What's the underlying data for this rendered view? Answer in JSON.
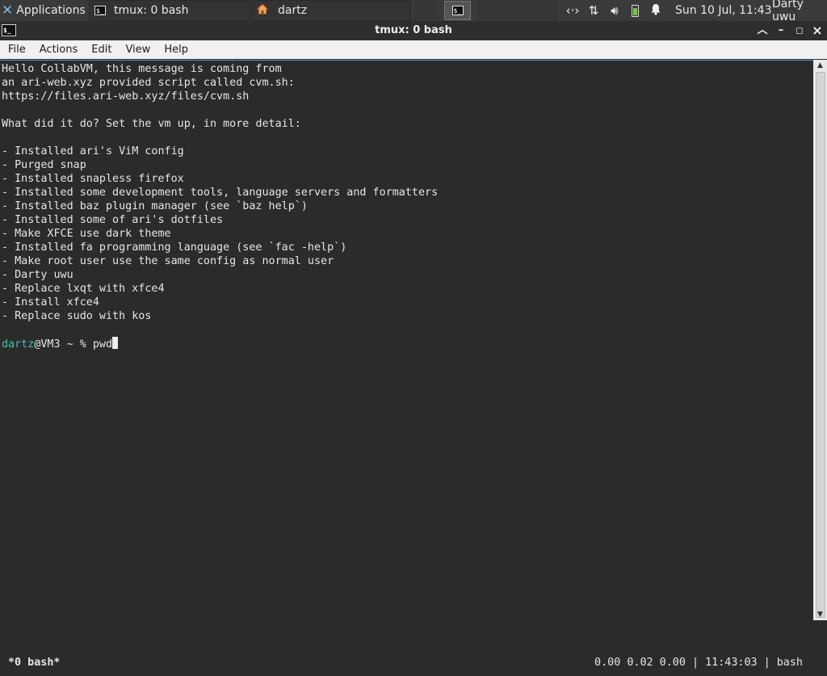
{
  "panel": {
    "apps_label": "Applications",
    "apps_suffix": "☰",
    "apps_icon": "xfce-logo-icon",
    "tasks": [
      {
        "label": "tmux: 0 bash",
        "icon": "terminal-icon"
      },
      {
        "label": "dartz",
        "icon": "home-folder-icon"
      }
    ],
    "tray_icons": [
      "network-icon",
      "transfer-arrows-icon",
      "volume-icon",
      "battery-icon",
      "notification-bell-icon"
    ],
    "clock": "Sun 10 Jul, 11:43",
    "user": "Darty uwu"
  },
  "window": {
    "title": "tmux: 0 bash",
    "controls": [
      "maximize-toggle",
      "minimize",
      "restore",
      "close"
    ]
  },
  "menubar": {
    "items": [
      "File",
      "Actions",
      "Edit",
      "View",
      "Help"
    ]
  },
  "terminal": {
    "lines": [
      "Hello CollabVM, this message is coming from",
      "an ari-web.xyz provided script called cvm.sh:",
      "https://files.ari-web.xyz/files/cvm.sh",
      "",
      "What did it do? Set the vm up, in more detail:",
      "",
      "- Installed ari's ViM config",
      "- Purged snap",
      "- Installed snapless firefox",
      "- Installed some development tools, language servers and formatters",
      "- Installed baz plugin manager (see `baz help`)",
      "- Installed some of ari's dotfiles",
      "- Make XFCE use dark theme",
      "- Installed fa programming language (see `fac -help`)",
      "- Make root user use the same config as normal user",
      "- Darty uwu",
      "- Replace lxqt with xfce4",
      "- Install xfce4",
      "- Replace sudo with kos",
      ""
    ],
    "prompt": {
      "user": "dartz",
      "rest": "@VM3 ~ % ",
      "command": "pwd"
    }
  },
  "tmux": {
    "window": "*0 bash*",
    "status": "0.00 0.02 0.00 | 11:43:03 | bash"
  },
  "colors": {
    "panel_bg": "#3a3a3a",
    "terminal_bg": "#2b2b2b",
    "prompt_user": "#3fc5a5",
    "accent": "#4a9fd9"
  }
}
